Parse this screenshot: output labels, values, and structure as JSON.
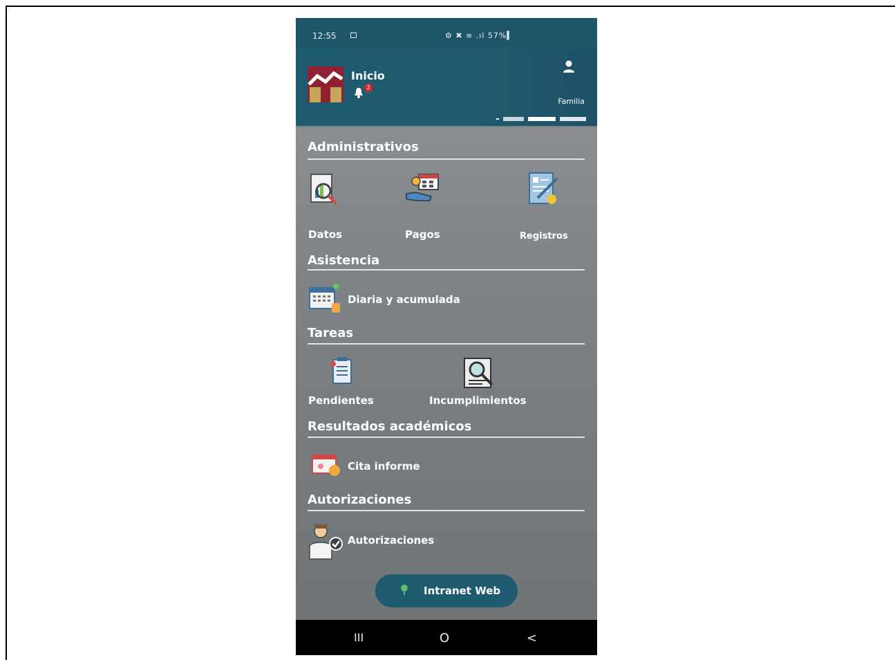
{
  "status": {
    "time": "12:55",
    "system": "⚙ ✖ ≡ .ıl 57%▍"
  },
  "header": {
    "title": "Inicio",
    "notifications": "2",
    "profile_label": "Familia"
  },
  "sections": [
    {
      "title": "Administrativos"
    },
    {
      "title": "Asistencia"
    },
    {
      "title": "Tareas"
    },
    {
      "title": "Resultados académicos"
    },
    {
      "title": "Autorizaciones"
    }
  ],
  "items": {
    "datos": "Datos",
    "pagos": "Pagos",
    "registros": "Registros",
    "diaria": "Diaria y acumulada",
    "pendientes": "Pendientes",
    "incumplimientos": "Incumplimientos",
    "cita": "Cita informe",
    "autorizaciones": "Autorizaciones"
  },
  "fab": {
    "label": "Intranet Web"
  },
  "navbar": {
    "recents": "III",
    "home": "O",
    "back": "<"
  },
  "colors": {
    "header": "#1e5a70",
    "logo_red": "#8f2130",
    "logo_gold": "#c6a65a",
    "badge": "#d52828"
  },
  "icons": [
    "calendar-icon",
    "bell-icon",
    "user-icon",
    "chart-magnifier-icon",
    "payment-hand-icon",
    "clipboard-edit-icon",
    "attendance-calendar-icon",
    "task-list-icon",
    "document-search-icon",
    "report-meeting-icon",
    "doctor-check-icon",
    "globe-icon"
  ]
}
